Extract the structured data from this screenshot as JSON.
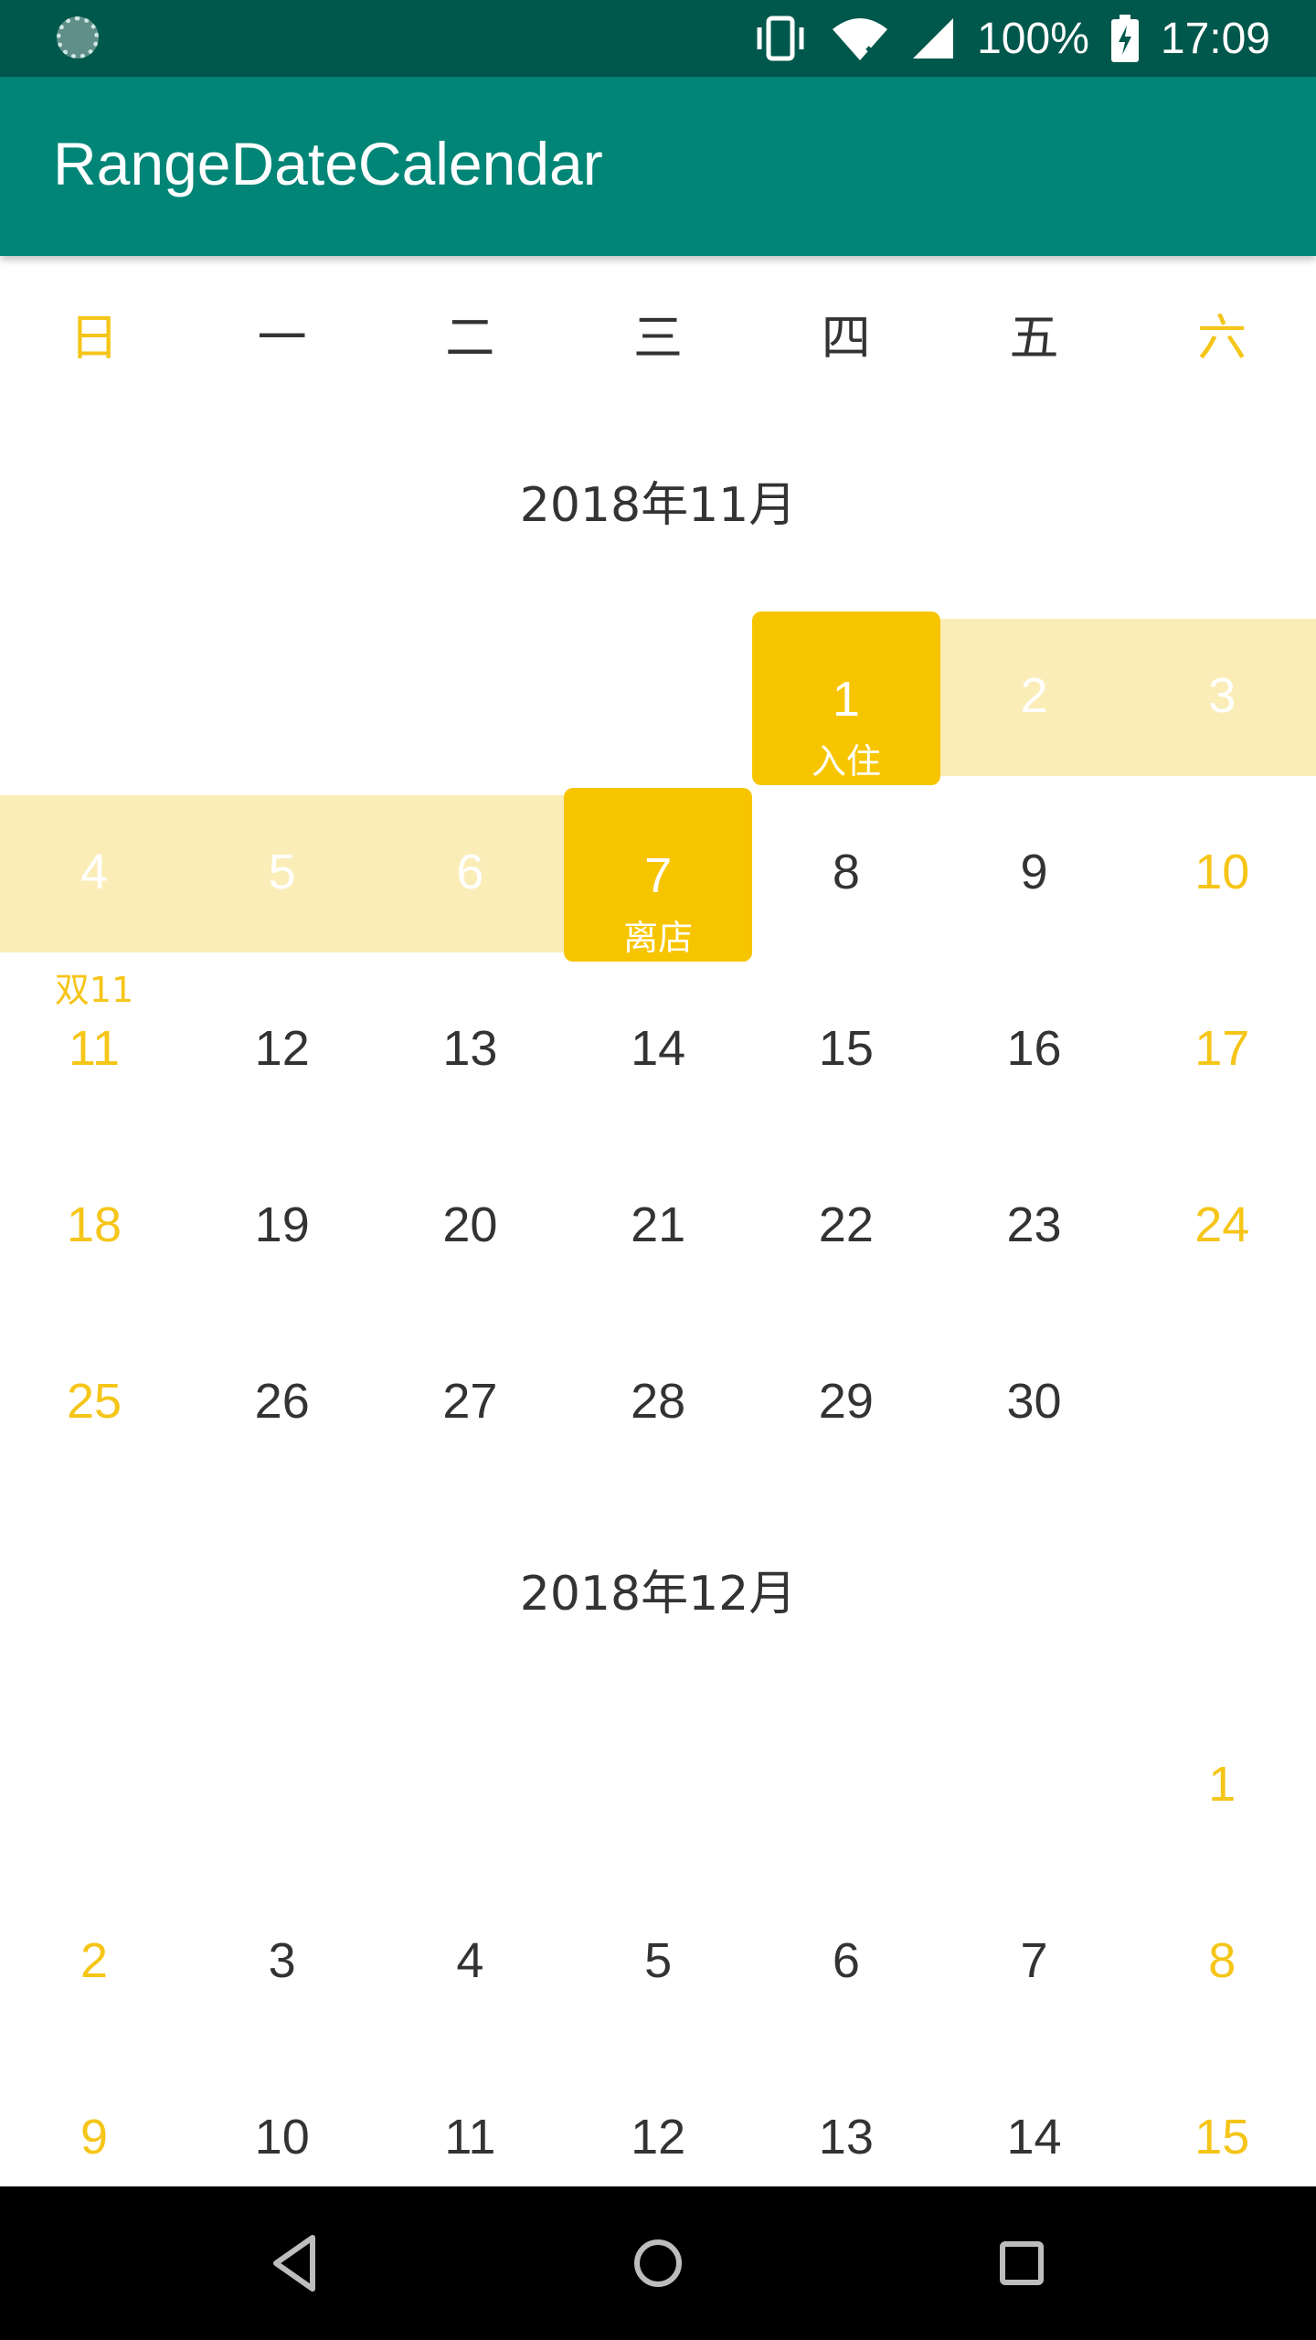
{
  "status_bar": {
    "battery": "100%",
    "time": "17:09"
  },
  "app_bar": {
    "title": "RangeDateCalendar"
  },
  "week_days": [
    "日",
    "一",
    "二",
    "三",
    "四",
    "五",
    "六"
  ],
  "months": [
    {
      "title": "2018年11月",
      "weeks": [
        [
          {
            "day": ""
          },
          {
            "day": ""
          },
          {
            "day": ""
          },
          {
            "day": ""
          },
          {
            "day": "1",
            "state": "start",
            "label": "入住"
          },
          {
            "day": "2",
            "state": "range"
          },
          {
            "day": "3",
            "state": "range"
          }
        ],
        [
          {
            "day": "4",
            "state": "range"
          },
          {
            "day": "5",
            "state": "range"
          },
          {
            "day": "6",
            "state": "range"
          },
          {
            "day": "7",
            "state": "end",
            "label": "离店"
          },
          {
            "day": "8"
          },
          {
            "day": "9"
          },
          {
            "day": "10"
          }
        ],
        [
          {
            "day": "11",
            "festival": "双11"
          },
          {
            "day": "12"
          },
          {
            "day": "13"
          },
          {
            "day": "14"
          },
          {
            "day": "15"
          },
          {
            "day": "16"
          },
          {
            "day": "17"
          }
        ],
        [
          {
            "day": "18"
          },
          {
            "day": "19"
          },
          {
            "day": "20"
          },
          {
            "day": "21"
          },
          {
            "day": "22"
          },
          {
            "day": "23"
          },
          {
            "day": "24"
          }
        ],
        [
          {
            "day": "25"
          },
          {
            "day": "26"
          },
          {
            "day": "27"
          },
          {
            "day": "28"
          },
          {
            "day": "29"
          },
          {
            "day": "30"
          },
          {
            "day": ""
          }
        ]
      ]
    },
    {
      "title": "2018年12月",
      "weeks": [
        [
          {
            "day": ""
          },
          {
            "day": ""
          },
          {
            "day": ""
          },
          {
            "day": ""
          },
          {
            "day": ""
          },
          {
            "day": ""
          },
          {
            "day": "1"
          }
        ],
        [
          {
            "day": "2"
          },
          {
            "day": "3"
          },
          {
            "day": "4"
          },
          {
            "day": "5"
          },
          {
            "day": "6"
          },
          {
            "day": "7"
          },
          {
            "day": "8"
          }
        ],
        [
          {
            "day": "9"
          },
          {
            "day": "10"
          },
          {
            "day": "11"
          },
          {
            "day": "12"
          },
          {
            "day": "13"
          },
          {
            "day": "14"
          },
          {
            "day": "15"
          }
        ]
      ]
    }
  ],
  "colors": {
    "status_bar": "#00574B",
    "app_bar": "#008577",
    "accent": "#F7C500",
    "range": "#FAEDB8",
    "weekend_text": "#F5C518"
  },
  "icons": {
    "status_left": "loading-icon",
    "vibrate": "vibrate-icon",
    "wifi": "wifi-off-icon",
    "signal": "signal-icon",
    "battery": "battery-charging-icon",
    "nav_back": "back-triangle-icon",
    "nav_home": "home-circle-icon",
    "nav_recents": "recents-square-icon"
  }
}
